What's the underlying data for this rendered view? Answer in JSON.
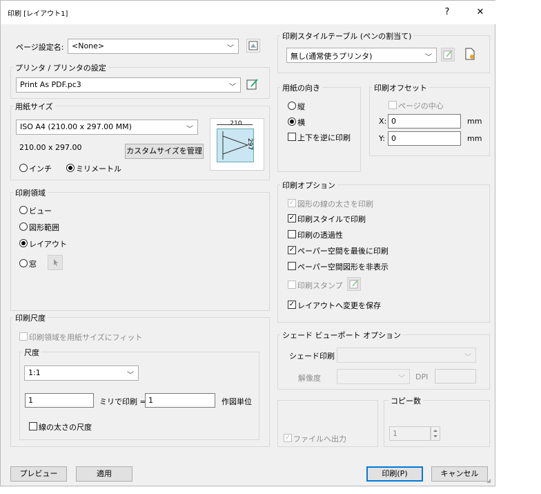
{
  "window": {
    "title": "印刷 [レイアウト1]",
    "help": "?",
    "close": "✕"
  },
  "page_setup": {
    "label": "ページ設定名:",
    "value": "<None>"
  },
  "printer": {
    "group": "プリンタ / プリンタの設定",
    "value": "Print As PDF.pc3"
  },
  "paper": {
    "group": "用紙サイズ",
    "value": "ISO A4 (210.00 x 297.00 MM)",
    "size_text": "210.00 x 297.00",
    "custom_button": "カスタムサイズを管理",
    "unit_inch": "インチ",
    "unit_mm": "ミリメートル",
    "preview_width": "210",
    "preview_height": "297"
  },
  "plot_area": {
    "group": "印刷領域",
    "options": [
      "ビュー",
      "図形範囲",
      "レイアウト",
      "窓"
    ],
    "selected": "レイアウト"
  },
  "plot_scale": {
    "group": "印刷尺度",
    "fit": "印刷領域を用紙サイズにフィット",
    "scale_group": "尺度",
    "scale_value": "1:1",
    "value1": "1",
    "units_label": "ミリで印刷 =",
    "value2": "1",
    "drawing_units": "作図単位",
    "lineweights": "線の太さの尺度"
  },
  "buttons": {
    "preview": "プレビュー",
    "apply": "適用",
    "print": "印刷(P)",
    "cancel": "キャンセル"
  },
  "style_table": {
    "group": "印刷スタイルテーブル (ペンの割当て)",
    "value": "無し(通常使うプリンタ)"
  },
  "orientation": {
    "group": "用紙の向き",
    "portrait": "縦",
    "landscape": "横",
    "upside_down": "上下を逆に印刷"
  },
  "offset": {
    "group": "印刷オフセット",
    "center": "ページの中心",
    "x_label": "X:",
    "x_value": "0",
    "y_label": "Y:",
    "y_value": "0",
    "unit": "mm"
  },
  "options": {
    "group": "印刷オプション",
    "items": [
      {
        "label": "図形の線の太さを印刷",
        "checked": true,
        "disabled": true
      },
      {
        "label": "印刷スタイルで印刷",
        "checked": true,
        "disabled": false
      },
      {
        "label": "印刷の透過性",
        "checked": false,
        "disabled": false
      },
      {
        "label": "ペーパー空間を最後に印刷",
        "checked": true,
        "disabled": false
      },
      {
        "label": "ペーパー空間図形を非表示",
        "checked": false,
        "disabled": false
      },
      {
        "label": "印刷スタンプ",
        "checked": false,
        "disabled": true
      },
      {
        "label": "レイアウトへ変更を保存",
        "checked": true,
        "disabled": false
      }
    ]
  },
  "shaded": {
    "group": "シェード ビューポート オプション",
    "shade_label": "シェード印刷",
    "quality_label": "解像度",
    "dpi": "DPI"
  },
  "output": {
    "to_file": "ファイルへ出力"
  },
  "copies": {
    "group": "コピー数",
    "value": "1"
  },
  "colors": {
    "accent": "#0078d7",
    "dialog_bg": "#f0f0f0",
    "border": "#d9d9d9"
  }
}
